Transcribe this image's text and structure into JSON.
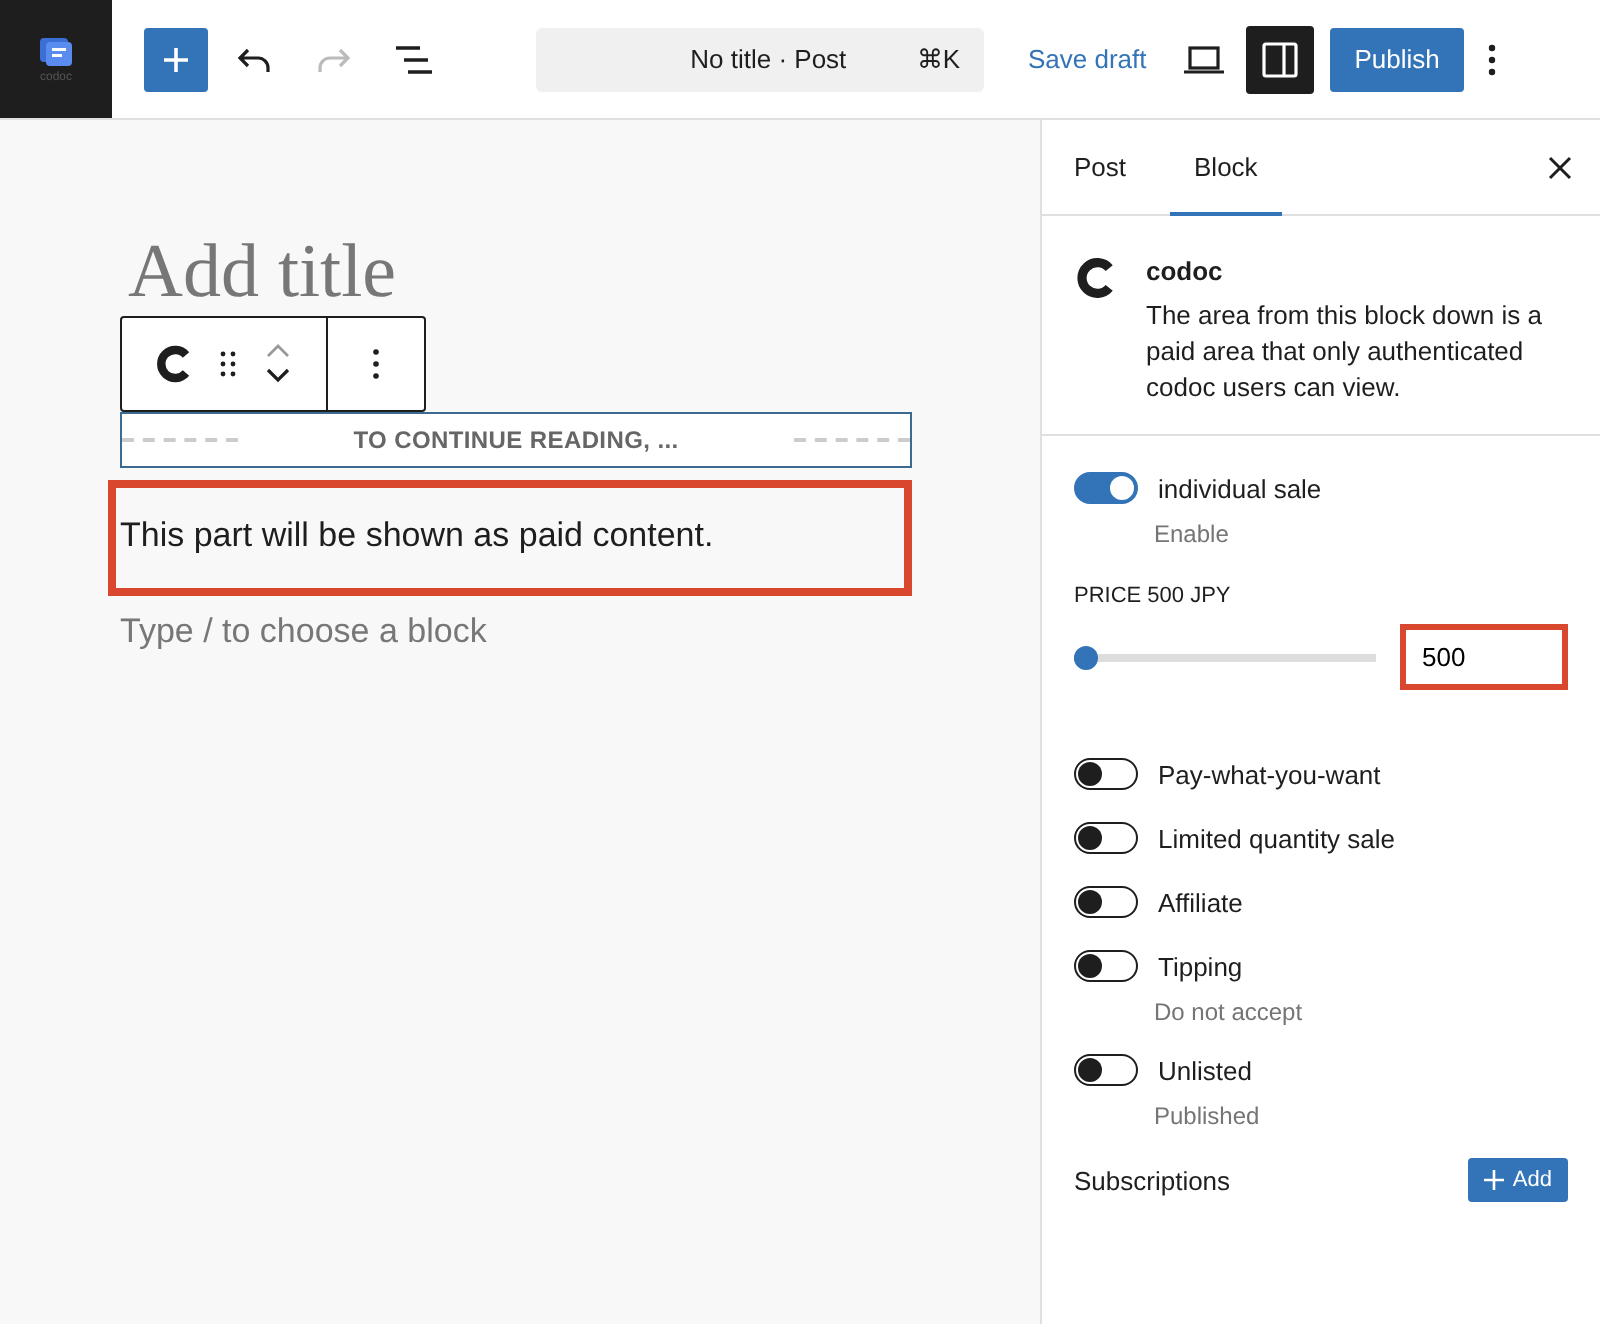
{
  "logo": {
    "text": "codoc"
  },
  "toolbar": {
    "redo_disabled": true,
    "document_title": "No title · Post",
    "shortcut": "⌘K",
    "save_draft": "Save draft",
    "sidebar_open": true,
    "publish": "Publish"
  },
  "editor": {
    "title_placeholder": "Add title",
    "paywall_label": "TO CONTINUE READING, ...",
    "paragraph": "This part will be shown as paid content.",
    "block_placeholder": "Type / to choose a block"
  },
  "sidebar": {
    "tabs": [
      {
        "label": "Post",
        "selected": false
      },
      {
        "label": "Block",
        "selected": true
      }
    ],
    "block": {
      "name": "codoc",
      "description": "The area from this block down is a paid area that only authenticated codoc users can view."
    },
    "sale": {
      "label": "individual sale",
      "on": true,
      "hint": "Enable"
    },
    "price": {
      "label": "PRICE 500 JPY",
      "level": 0.0,
      "value": "500"
    },
    "pay_what_you_want": {
      "label": "Pay-what-you-want",
      "on": false
    },
    "options": [
      {
        "label": "Limited quantity sale",
        "on": false
      },
      {
        "label": "Affiliate",
        "on": false
      },
      {
        "label": "Tipping",
        "on": false,
        "hint": "Do not accept"
      },
      {
        "label": "Unlisted",
        "on": false,
        "hint": "Published"
      }
    ],
    "subscriptions": {
      "label": "Subscriptions",
      "button": "Add"
    }
  }
}
